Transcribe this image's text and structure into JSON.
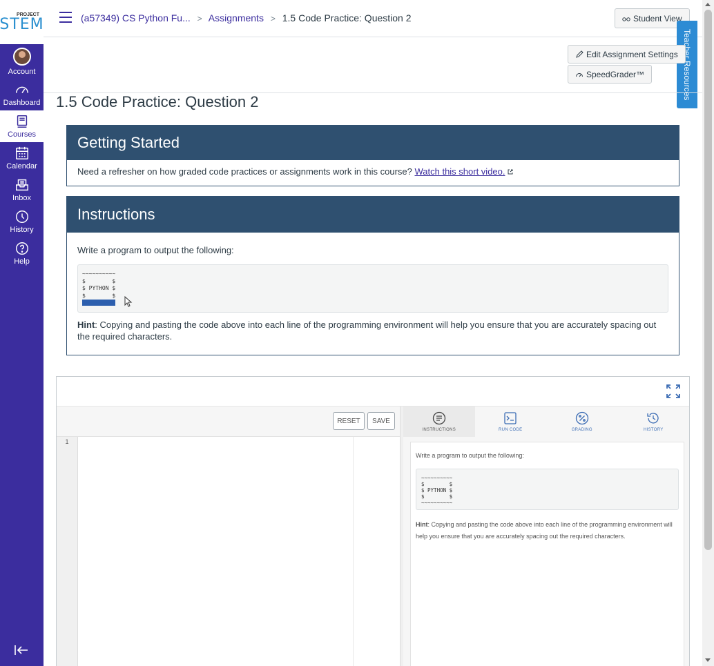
{
  "logo": {
    "top": "PROJECT",
    "main": "STEM"
  },
  "nav": {
    "account": "Account",
    "dashboard": "Dashboard",
    "courses": "Courses",
    "calendar": "Calendar",
    "inbox": "Inbox",
    "history": "History",
    "help": "Help"
  },
  "breadcrumb": {
    "course": "(a57349) CS Python Fu...",
    "section": "Assignments",
    "current": "1.5 Code Practice: Question 2"
  },
  "buttons": {
    "student_view": "Student View",
    "edit_settings": "Edit Assignment Settings",
    "speedgrader": "SpeedGrader™"
  },
  "teacher_resources": "Teacher Resources",
  "page_title": "1.5 Code Practice: Question 2",
  "getting_started": {
    "title": "Getting Started",
    "text": "Need a refresher on how graded code practices or assignments work in this course?",
    "link": "Watch this short video."
  },
  "instructions": {
    "title": "Instructions",
    "prompt": "Write a program to output the following:",
    "code_lines": [
      "~~~~~~~~~~",
      "$        $",
      "$ PYTHON $",
      "$        $",
      "~~~~~~~~~~"
    ],
    "hint_label": "Hint",
    "hint_text": ": Copying and pasting the code above into each line of the programming environment will help you ensure that you are accurately spacing out the required characters."
  },
  "ide": {
    "reset": "RESET",
    "save": "SAVE",
    "line_number": "1",
    "tabs": [
      "INSTRUCTIONS",
      "RUN CODE",
      "GRADING",
      "HISTORY"
    ],
    "panel_prompt": "Write a program to output the following:",
    "panel_code": "~~~~~~~~~~\n$        $\n$ PYTHON $\n$        $\n~~~~~~~~~~",
    "panel_hint_label": "Hint",
    "panel_hint_text": ": Copying and pasting the code above into each line of the programming environment will help you ensure that you are accurately spacing out the required characters."
  },
  "colors": {
    "nav": "#3b2d9e",
    "panel_header": "#2f5070",
    "teacher_tab": "#2c8bd4"
  }
}
